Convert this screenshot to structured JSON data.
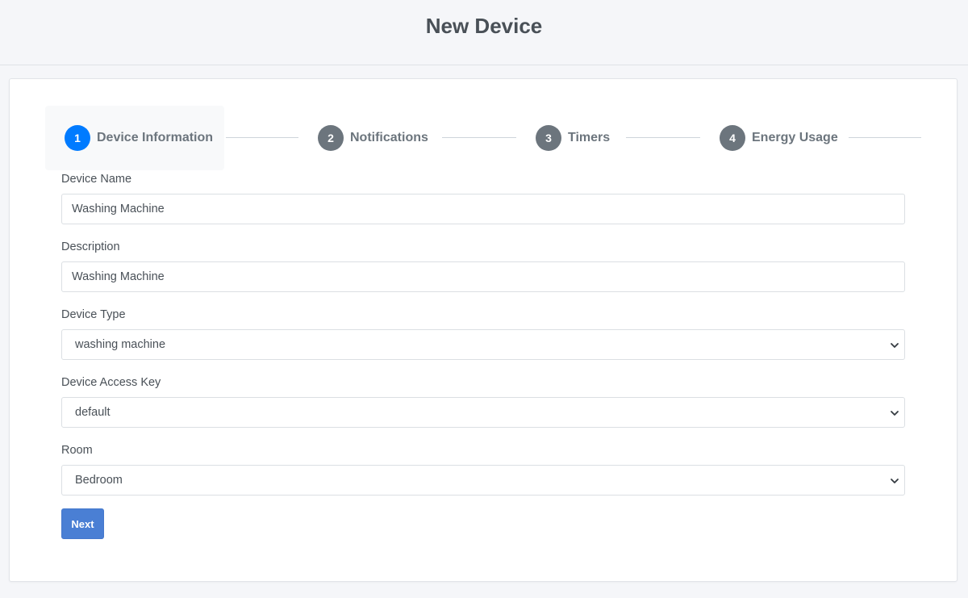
{
  "page": {
    "title": "New Device"
  },
  "stepper": {
    "steps": [
      {
        "number": "1",
        "label": "Device Information",
        "active": true
      },
      {
        "number": "2",
        "label": "Notifications",
        "active": false
      },
      {
        "number": "3",
        "label": "Timers",
        "active": false
      },
      {
        "number": "4",
        "label": "Energy Usage",
        "active": false
      }
    ]
  },
  "form": {
    "device_name": {
      "label": "Device Name",
      "value": "Washing Machine"
    },
    "description": {
      "label": "Description",
      "value": "Washing Machine"
    },
    "device_type": {
      "label": "Device Type",
      "value": "washing machine"
    },
    "access_key": {
      "label": "Device Access Key",
      "value": "default"
    },
    "room": {
      "label": "Room",
      "value": "Bedroom"
    },
    "next_label": "Next"
  },
  "colors": {
    "active_step": "#007bff",
    "inactive_step": "#6c757d",
    "primary_button": "#4a7fd4"
  }
}
